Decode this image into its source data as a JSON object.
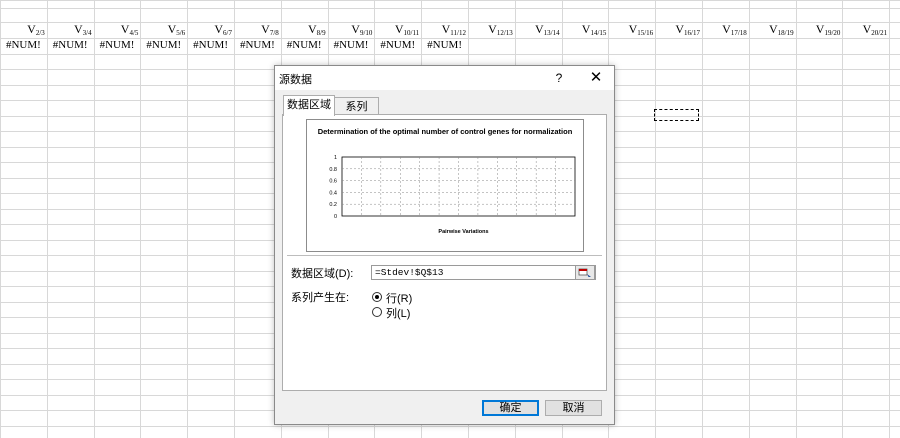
{
  "sheet": {
    "column_headers": [
      {
        "base": "V",
        "sub": "2/3"
      },
      {
        "base": "V",
        "sub": "3/4"
      },
      {
        "base": "V",
        "sub": "4/5"
      },
      {
        "base": "V",
        "sub": "5/6"
      },
      {
        "base": "V",
        "sub": "6/7"
      },
      {
        "base": "V",
        "sub": "7/8"
      },
      {
        "base": "V",
        "sub": "8/9"
      },
      {
        "base": "V",
        "sub": "9/10"
      },
      {
        "base": "V",
        "sub": "10/11"
      },
      {
        "base": "V",
        "sub": "11/12"
      },
      {
        "base": "V",
        "sub": "12/13"
      },
      {
        "base": "V",
        "sub": "13/14"
      },
      {
        "base": "V",
        "sub": "14/15"
      },
      {
        "base": "V",
        "sub": "15/16"
      },
      {
        "base": "V",
        "sub": "16/17"
      },
      {
        "base": "V",
        "sub": "17/18"
      },
      {
        "base": "V",
        "sub": "18/19"
      },
      {
        "base": "V",
        "sub": "19/20"
      },
      {
        "base": "V",
        "sub": "20/21"
      }
    ],
    "error_values": [
      "#NUM!",
      "#NUM!",
      "#NUM!",
      "#NUM!",
      "#NUM!",
      "#NUM!",
      "#NUM!",
      "#NUM!",
      "#NUM!",
      "#NUM!"
    ]
  },
  "dialog": {
    "title": "源数据",
    "help_label": "?",
    "close_label": "✕",
    "tabs": [
      {
        "label": "数据区域",
        "active": true
      },
      {
        "label": "系列",
        "active": false
      }
    ],
    "range_label": "数据区域(D):",
    "range_value": "=Stdev!$Q$13",
    "series_in_label": "系列产生在:",
    "options": [
      {
        "label": "行(R)",
        "selected": true
      },
      {
        "label": "列(L)",
        "selected": false
      }
    ],
    "ok_label": "确定",
    "cancel_label": "取消"
  },
  "chart_data": {
    "type": "bar",
    "title": "Determination of the optimal number of control genes for normalization",
    "xlabel": "Pairwise Variations",
    "ylabel": "",
    "ylim": [
      0,
      1
    ],
    "y_ticks": [
      "1",
      "0.8",
      "0.6",
      "0.4",
      "0.2",
      "0"
    ],
    "categories": [],
    "values": [],
    "grid": true
  }
}
